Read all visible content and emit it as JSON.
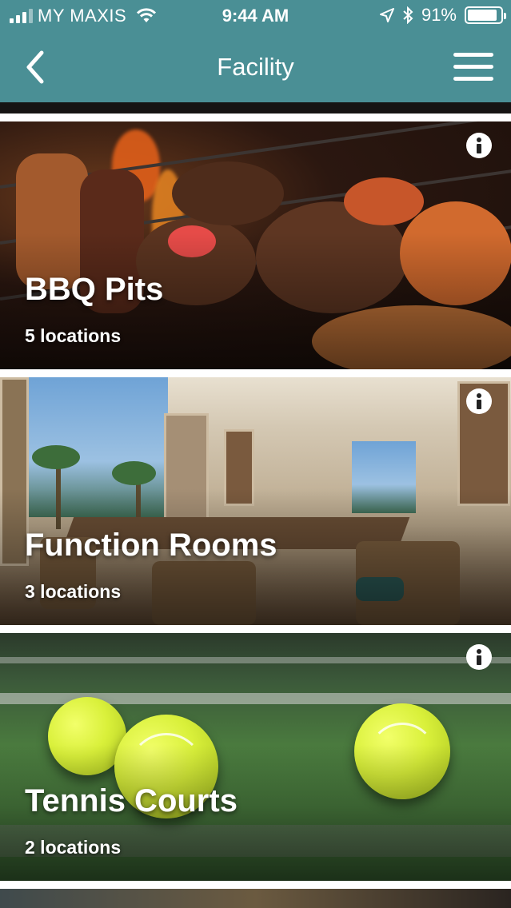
{
  "status_bar": {
    "carrier": "MY MAXIS",
    "time": "9:44 AM",
    "battery": "91%",
    "battery_level": 0.91
  },
  "nav": {
    "title": "Facility",
    "back_icon": "chevron-left-icon",
    "menu_icon": "hamburger-menu-icon"
  },
  "facilities": [
    {
      "name": "BBQ Pits",
      "locations": "5 locations"
    },
    {
      "name": "Function Rooms",
      "locations": "3 locations"
    },
    {
      "name": "Tennis Courts",
      "locations": "2 locations"
    }
  ],
  "colors": {
    "header": "#4a8f95",
    "text_on_image": "#ffffff"
  }
}
